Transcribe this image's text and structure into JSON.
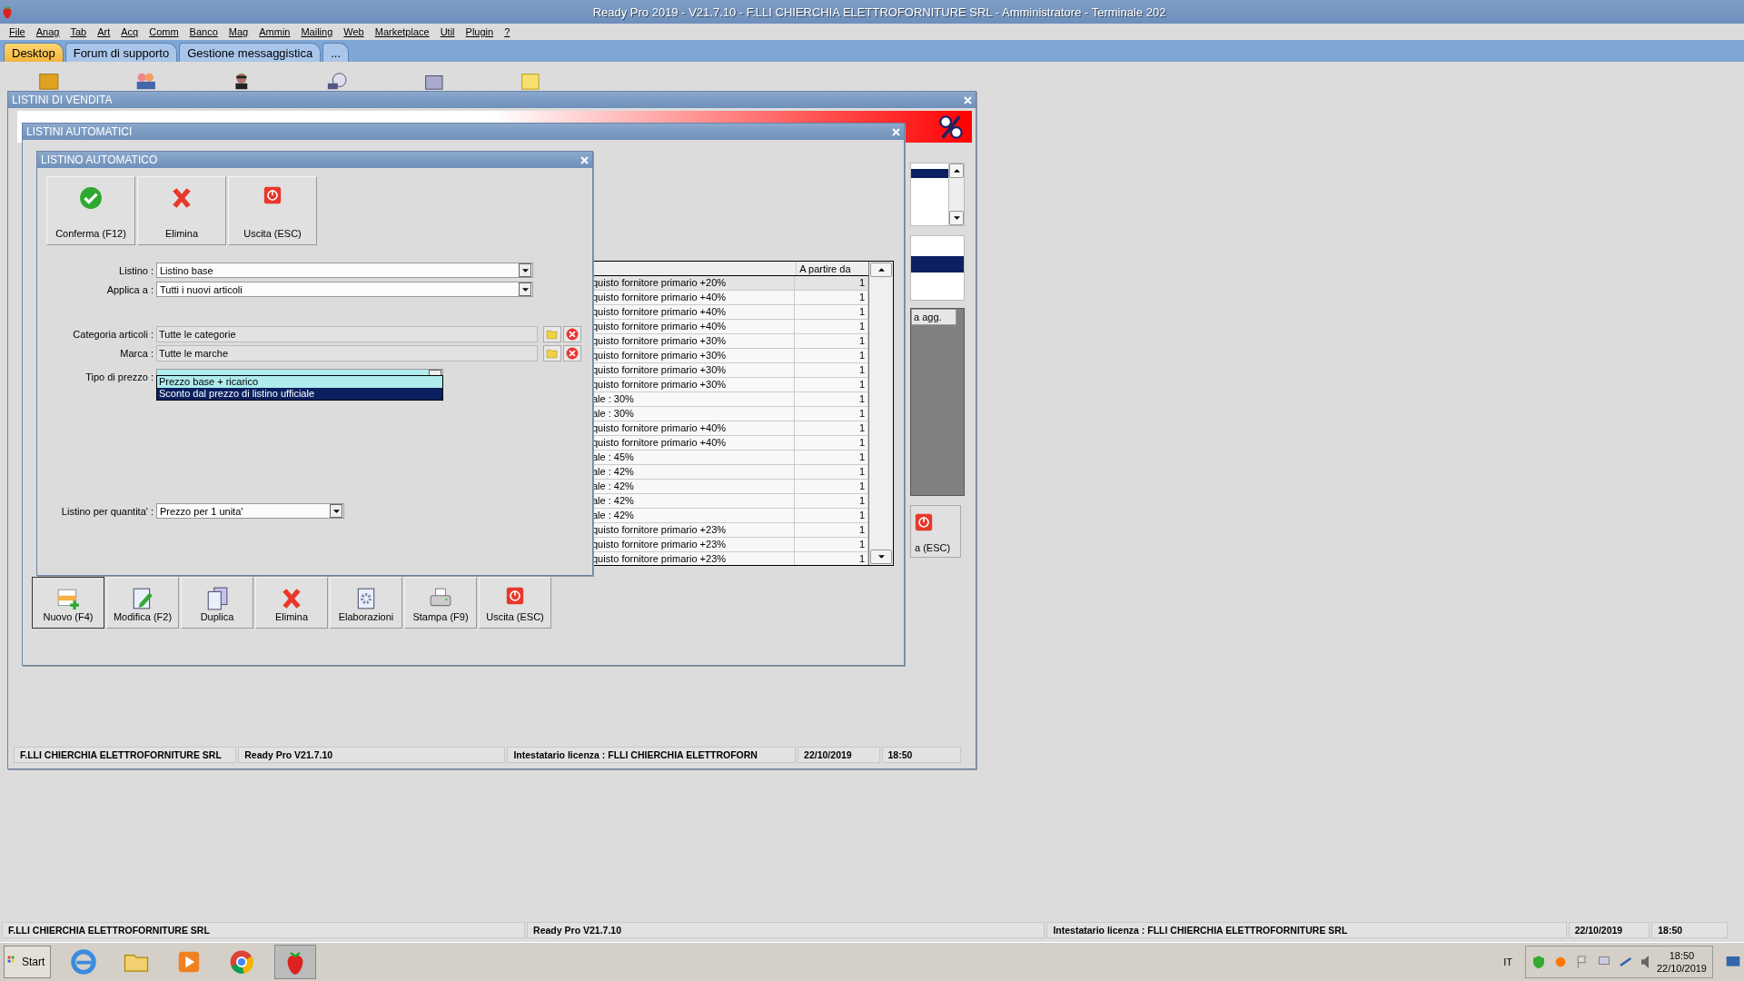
{
  "app_title": "Ready Pro 2019 - V21.7.10 - F.LLI CHIERCHIA ELETTROFORNITURE SRL - Amministratore - Terminale 202",
  "menu": [
    "File",
    "Anag",
    "Tab",
    "Art",
    "Acq",
    "Comm",
    "Banco",
    "Mag",
    "Ammin",
    "Mailing",
    "Web",
    "Marketplace",
    "Util",
    "Plugin",
    "?"
  ],
  "tabs": [
    {
      "label": "Desktop",
      "selected": true
    },
    {
      "label": "Forum di supporto",
      "selected": false
    },
    {
      "label": "Gestione messaggistica",
      "selected": false
    },
    {
      "label": "...",
      "selected": false
    }
  ],
  "sales_window": {
    "title": "LISTINI DI VENDITA",
    "side_column_header": "a agg.",
    "side_button": "a (ESC)",
    "status_bar": [
      "F.LLI CHIERCHIA ELETTROFORNITURE SRL",
      "Ready Pro V21.7.10",
      "Intestatario licenza : FLLI CHIERCHIA ELETTROFORN",
      "22/10/2019",
      "18:50"
    ]
  },
  "auto_window": {
    "title": "LISTINI AUTOMATICI",
    "table": {
      "columns": [
        "A partire da"
      ],
      "rows": [
        {
          "column_1": "quisto fornitore primario +20%",
          "from": "1",
          "selected": true
        },
        {
          "column_1": "quisto fornitore primario +40%",
          "from": "1",
          "selected": false
        },
        {
          "column_1": "quisto fornitore primario +40%",
          "from": "1",
          "selected": false
        },
        {
          "column_1": "quisto fornitore primario +40%",
          "from": "1",
          "selected": false
        },
        {
          "column_1": "quisto fornitore primario +30%",
          "from": "1",
          "selected": false
        },
        {
          "column_1": "quisto fornitore primario +30%",
          "from": "1",
          "selected": false
        },
        {
          "column_1": "quisto fornitore primario +30%",
          "from": "1",
          "selected": false
        },
        {
          "column_1": "quisto fornitore primario +30%",
          "from": "1",
          "selected": false
        },
        {
          "column_1": "ale : 30%",
          "from": "1",
          "selected": false
        },
        {
          "column_1": "ale : 30%",
          "from": "1",
          "selected": false
        },
        {
          "column_1": "quisto fornitore primario +40%",
          "from": "1",
          "selected": false
        },
        {
          "column_1": "quisto fornitore primario +40%",
          "from": "1",
          "selected": false
        },
        {
          "column_1": "ale : 45%",
          "from": "1",
          "selected": false
        },
        {
          "column_1": "ale : 42%",
          "from": "1",
          "selected": false
        },
        {
          "column_1": "ale : 42%",
          "from": "1",
          "selected": false
        },
        {
          "column_1": "ale : 42%",
          "from": "1",
          "selected": false
        },
        {
          "column_1": "ale : 42%",
          "from": "1",
          "selected": false
        },
        {
          "column_1": "quisto fornitore primario +23%",
          "from": "1",
          "selected": false
        },
        {
          "column_1": "quisto fornitore primario +23%",
          "from": "1",
          "selected": false
        },
        {
          "column_1": "quisto fornitore primario +23%",
          "from": "1",
          "selected": false
        }
      ]
    },
    "buttons": [
      {
        "kind": "new",
        "label": "Nuovo (F4)"
      },
      {
        "kind": "edit",
        "label": "Modifica (F2)"
      },
      {
        "kind": "duplicate",
        "label": "Duplica"
      },
      {
        "kind": "delete",
        "label": "Elimina"
      },
      {
        "kind": "process",
        "label": "Elaborazioni"
      },
      {
        "kind": "print",
        "label": "Stampa (F9)"
      },
      {
        "kind": "exit",
        "label": "Uscita (ESC)"
      }
    ]
  },
  "dialog": {
    "title": "LISTINO AUTOMATICO",
    "buttons": [
      {
        "kind": "confirm",
        "label": "Conferma (F12)"
      },
      {
        "kind": "delete",
        "label": "Elimina"
      },
      {
        "kind": "exit",
        "label": "Uscita (ESC)"
      }
    ],
    "listino": {
      "label": "Listino :",
      "value": "Listino base"
    },
    "applica": {
      "label": "Applica a :",
      "value": "Tutti i nuovi articoli"
    },
    "categoria": {
      "label": "Categoria articoli :",
      "value": "Tutte le categorie"
    },
    "marca": {
      "label": "Marca :",
      "value": "Tutte le marche"
    },
    "tipo_prezzo": {
      "label": "Tipo di prezzo :",
      "expanded": true,
      "options": [
        {
          "label": "Prezzo base + ricarico",
          "selected": false
        },
        {
          "label": "Sconto dal prezzo di listino ufficiale",
          "selected": true
        }
      ]
    },
    "quantita": {
      "label": "Listino per quantita' :",
      "value": "Prezzo per 1 unita'"
    }
  },
  "status_bar": [
    "F.LLI CHIERCHIA ELETTROFORNITURE SRL",
    "Ready Pro V21.7.10",
    "Intestatario licenza : FLLI CHIERCHIA ELETTROFORNITURE SRL",
    "22/10/2019",
    "18:50"
  ],
  "taskbar": {
    "start": "Start",
    "language": "IT",
    "time": "18:50",
    "date": "22/10/2019"
  }
}
